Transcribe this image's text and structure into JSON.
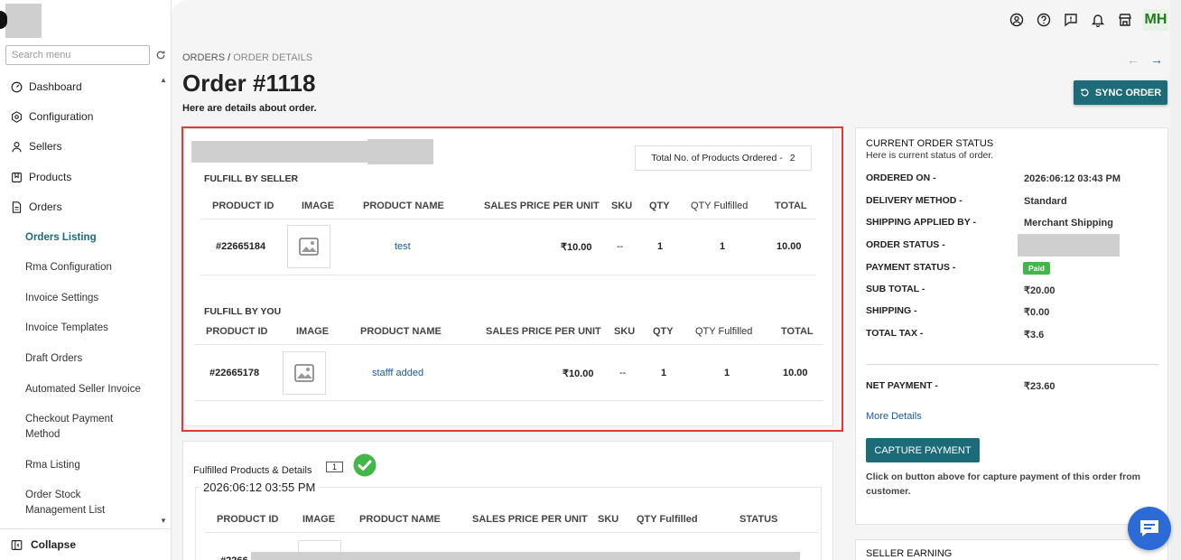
{
  "sidebar": {
    "search_placeholder": "Search menu",
    "items": [
      {
        "label": "Dashboard",
        "icon": "dashboard-icon"
      },
      {
        "label": "Configuration",
        "icon": "gear-icon"
      },
      {
        "label": "Sellers",
        "icon": "user-icon"
      },
      {
        "label": "Products",
        "icon": "bookmark-icon"
      },
      {
        "label": "Orders",
        "icon": "document-icon"
      }
    ],
    "sub_items": [
      "Orders Listing",
      "Rma Configuration",
      "Invoice Settings",
      "Invoice Templates",
      "Draft Orders",
      "Automated Seller Invoice",
      "Checkout Payment Method",
      "Rma Listing",
      "Order Stock Management List"
    ],
    "collapse_label": "Collapse"
  },
  "topbar": {
    "avatar": "MH"
  },
  "header": {
    "breadcrumb_root": "ORDERS",
    "breadcrumb_sep": "/",
    "breadcrumb_current": "ORDER DETAILS",
    "title": "Order #1118",
    "subtitle": "Here are details about order.",
    "sync_label": "SYNC ORDER"
  },
  "order": {
    "total_products_label": "Total No. of Products Ordered -",
    "total_products_value": "2",
    "seller_section": "FULFILL BY SELLER",
    "you_section": "FULFILL BY YOU",
    "columns": [
      "PRODUCT ID",
      "IMAGE",
      "PRODUCT NAME",
      "SALES PRICE PER UNIT",
      "SKU",
      "QTY",
      "QTY Fulfilled",
      "TOTAL"
    ],
    "seller_row": {
      "id": "#22665184",
      "name": "test",
      "price": "₹10.00",
      "sku": "--",
      "qty": "1",
      "fulfilled": "1",
      "total": "10.00"
    },
    "you_row": {
      "id": "#22665178",
      "name": "stafff added",
      "price": "₹10.00",
      "sku": "--",
      "qty": "1",
      "fulfilled": "1",
      "total": "10.00"
    }
  },
  "fulfilled": {
    "label": "Fulfilled Products & Details",
    "count": "1",
    "date": "2026:06:12 03:55 PM",
    "columns": [
      "PRODUCT ID",
      "IMAGE",
      "PRODUCT NAME",
      "SALES PRICE PER UNIT",
      "SKU",
      "QTY Fulfilled",
      "STATUS"
    ],
    "row_id_partial": "#2266"
  },
  "status_panel": {
    "title": "CURRENT ORDER STATUS",
    "subtitle": "Here is current status of order.",
    "rows": [
      {
        "key": "ORDERED ON -",
        "value": "2026:06:12 03:43 PM"
      },
      {
        "key": "DELIVERY METHOD -",
        "value": "Standard"
      },
      {
        "key": "SHIPPING APPLIED BY -",
        "value": "Merchant Shipping"
      },
      {
        "key": "ORDER STATUS -",
        "value": ""
      },
      {
        "key": "PAYMENT STATUS -",
        "value": "Paid"
      },
      {
        "key": "SUB TOTAL -",
        "value": "₹20.00"
      },
      {
        "key": "SHIPPING -",
        "value": "₹0.00"
      },
      {
        "key": "TOTAL TAX -",
        "value": "₹3.6"
      }
    ],
    "net_key": "NET PAYMENT -",
    "net_value": "₹23.60",
    "more_details": "More Details",
    "capture_label": "CAPTURE PAYMENT",
    "capture_note": "Click on button above for capture payment of this order from customer."
  },
  "seller_earning": {
    "title": "SELLER EARNING"
  },
  "colors": {
    "accent": "#1b6b78",
    "link": "#1b5aa6",
    "paid": "#43b649",
    "highlight": "#e53935",
    "chat": "#2c6bd6"
  }
}
